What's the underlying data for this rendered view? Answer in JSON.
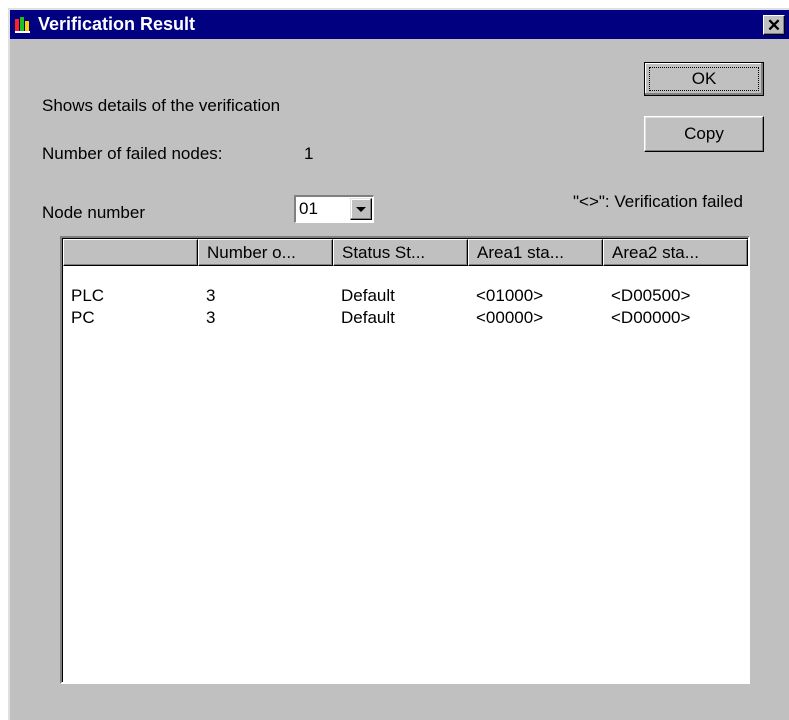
{
  "window": {
    "title": "Verification Result",
    "close_glyph": "✕",
    "icon": "app-icon"
  },
  "buttons": {
    "ok_label": "OK",
    "copy_label": "Copy"
  },
  "info": {
    "description": "Shows details of the verification",
    "failed_nodes_label": "Number of failed nodes:",
    "failed_nodes_value": "1",
    "node_number_label": "Node number",
    "node_number_value": "01",
    "legend": "\"<>\": Verification failed"
  },
  "table": {
    "columns": [
      "",
      "Number o...",
      "Status St...",
      "Area1 sta...",
      "Area2 sta..."
    ],
    "rows": [
      [
        "PLC",
        "3",
        "Default",
        "<01000>",
        "<D00500>"
      ],
      [
        "PC",
        "3",
        "Default",
        "<00000>",
        "<D00000>"
      ]
    ]
  }
}
